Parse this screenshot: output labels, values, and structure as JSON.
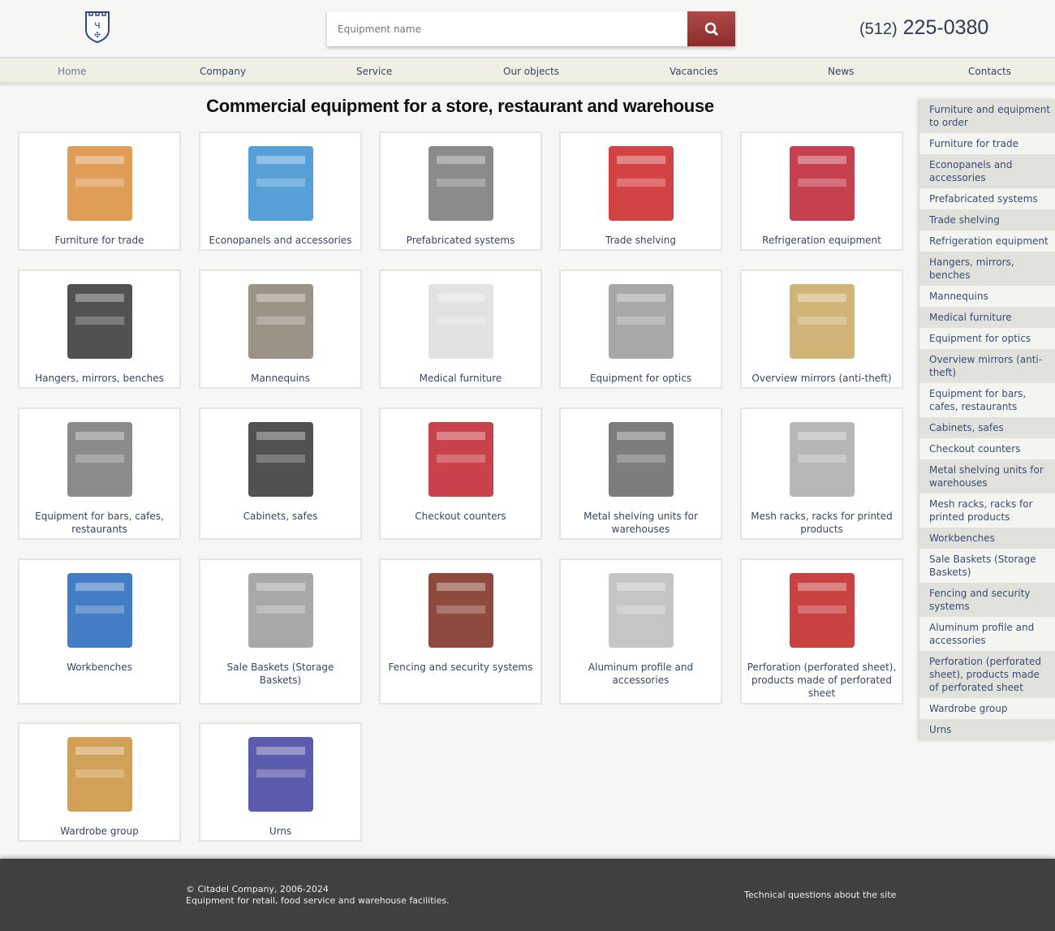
{
  "header": {
    "search_placeholder": "Equipment name",
    "phone_code": "(512)",
    "phone_number": "225-0380",
    "accent": "#9a3535"
  },
  "nav": [
    "Home",
    "Company",
    "Service",
    "Our objects",
    "Vacancies",
    "News",
    "Contacts"
  ],
  "page_title": "Commercial equipment for a store, restaurant and warehouse",
  "products": [
    {
      "label": "Furniture for trade",
      "color": "#d98c3a"
    },
    {
      "label": "Econopanels and accessories",
      "color": "#3a8fd0"
    },
    {
      "label": "Prefabricated systems",
      "color": "#777777"
    },
    {
      "label": "Trade shelving",
      "color": "#cc2222"
    },
    {
      "label": "Refrigeration equipment",
      "color": "#bb2030"
    },
    {
      "label": "Hangers, mirrors, benches",
      "color": "#333333"
    },
    {
      "label": "Mannequins",
      "color": "#8a8070"
    },
    {
      "label": "Medical furniture",
      "color": "#dddddd"
    },
    {
      "label": "Equipment for optics",
      "color": "#999999"
    },
    {
      "label": "Overview mirrors (anti-theft)",
      "color": "#c9a860"
    },
    {
      "label": "Equipment for bars, cafes, restaurants",
      "color": "#777777"
    },
    {
      "label": "Cabinets, safes",
      "color": "#333333"
    },
    {
      "label": "Checkout counters",
      "color": "#c0202a"
    },
    {
      "label": "Metal shelving units for warehouses",
      "color": "#666666"
    },
    {
      "label": "Mesh racks, racks for printed products",
      "color": "#aaaaaa"
    },
    {
      "label": "Workbenches",
      "color": "#2266bb"
    },
    {
      "label": "Sale Baskets (Storage Baskets)",
      "color": "#999999"
    },
    {
      "label": "Fencing and security systems",
      "color": "#7a2a1a"
    },
    {
      "label": "Aluminum profile and accessories",
      "color": "#bbbbbb"
    },
    {
      "label": "Perforation (perforated sheet), products made of perforated sheet",
      "color": "#c02020"
    },
    {
      "label": "Wardrobe group",
      "color": "#c8903a"
    },
    {
      "label": "Urns",
      "color": "#4040a0"
    }
  ],
  "sidebar": [
    "Furniture and equipment to order",
    "Furniture for trade",
    "Econopanels and accessories",
    "Prefabricated systems",
    "Trade shelving",
    "Refrigeration equipment",
    "Hangers, mirrors, benches",
    "Mannequins",
    "Medical furniture",
    "Equipment for optics",
    "Overview mirrors (anti-theft)",
    "Equipment for bars, cafes, restaurants",
    "Cabinets, safes",
    "Checkout counters",
    "Metal shelving units for warehouses",
    "Mesh racks, racks for printed products",
    "Workbenches",
    "Sale Baskets (Storage Baskets)",
    "Fencing and security systems",
    "Aluminum profile and accessories",
    "Perforation (perforated sheet), products made of perforated sheet",
    "Wardrobe group",
    "Urns"
  ],
  "footer": {
    "copyright": "© Citadel Company, 2006-2024",
    "tagline": "Equipment for retail, food service and warehouse facilities.",
    "tech_link": "Technical questions about the site"
  }
}
